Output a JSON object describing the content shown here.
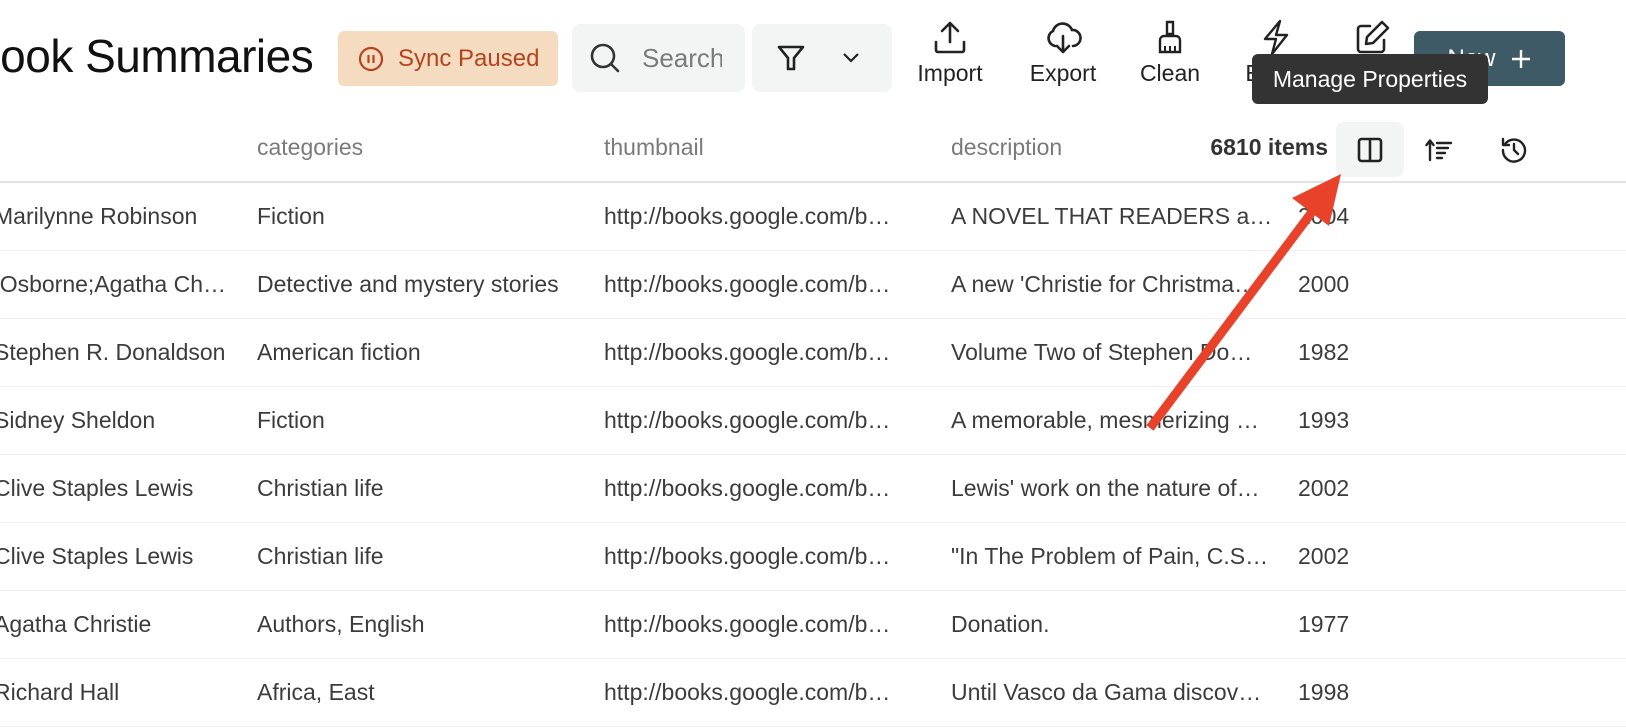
{
  "header": {
    "title": "Book Summaries",
    "sync_status": "Sync Paused",
    "search_placeholder": "Search",
    "toolbar": {
      "import_label": "Import",
      "export_label": "Export",
      "clean_label": "Clean",
      "enrich_label": "E",
      "new_label": "New"
    },
    "tooltip": "Manage Properties"
  },
  "table": {
    "columns": [
      "categories",
      "thumbnail",
      "description"
    ],
    "items_count": "6810 items",
    "rows": [
      {
        "author": "Marilynne Robinson",
        "categories": "Fiction",
        "thumbnail": "http://books.google.com/b…",
        "description": "A NOVEL THAT READERS a…",
        "year": "2004"
      },
      {
        "author": "Charles Osborne;Agatha Ch…",
        "categories": "Detective and mystery stories",
        "thumbnail": "http://books.google.com/b…",
        "description": "A new 'Christie for Christma…",
        "year": "2000"
      },
      {
        "author": "Stephen R. Donaldson",
        "categories": "American fiction",
        "thumbnail": "http://books.google.com/b…",
        "description": "Volume Two of Stephen Do…",
        "year": "1982"
      },
      {
        "author": "Sidney Sheldon",
        "categories": "Fiction",
        "thumbnail": "http://books.google.com/b…",
        "description": "A memorable, mesmerizing …",
        "year": "1993"
      },
      {
        "author": "Clive Staples Lewis",
        "categories": "Christian life",
        "thumbnail": "http://books.google.com/b…",
        "description": "Lewis' work on the nature of…",
        "year": "2002"
      },
      {
        "author": "Clive Staples Lewis",
        "categories": "Christian life",
        "thumbnail": "http://books.google.com/b…",
        "description": "\"In The Problem of Pain, C.S…",
        "year": "2002"
      },
      {
        "author": "Agatha Christie",
        "categories": "Authors, English",
        "thumbnail": "http://books.google.com/b…",
        "description": "Donation.",
        "year": "1977"
      },
      {
        "author": "Richard Hall",
        "categories": "Africa, East",
        "thumbnail": "http://books.google.com/b…",
        "description": "Until Vasco da Gama discov…",
        "year": "1998"
      }
    ]
  },
  "colors": {
    "sync_badge_bg": "#F5DCC0",
    "sync_badge_text": "#B5441E",
    "new_button_bg": "#3E5A66",
    "tooltip_bg": "#333333",
    "annotation_arrow": "#E8432A"
  }
}
